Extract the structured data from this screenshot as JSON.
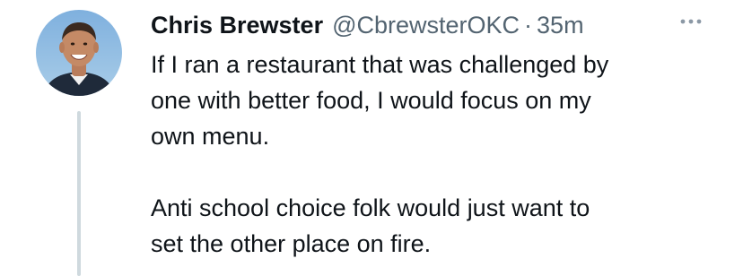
{
  "tweet": {
    "display_name": "Chris Brewster",
    "handle": "@CbrewsterOKC",
    "separator": "·",
    "time": "35m",
    "text_lines_p1": [
      "If I ran a restaurant that was challenged by",
      "one with better food, I would focus on my",
      "own menu."
    ],
    "text_lines_p2": [
      "Anti school choice folk would just want to",
      "set the other place on fire."
    ]
  },
  "icons": {
    "more": "more-horizontal-icon",
    "avatar": "profile-photo"
  },
  "colors": {
    "text": "#0f1419",
    "secondary": "#536471",
    "thread_line": "#cfd9de"
  }
}
